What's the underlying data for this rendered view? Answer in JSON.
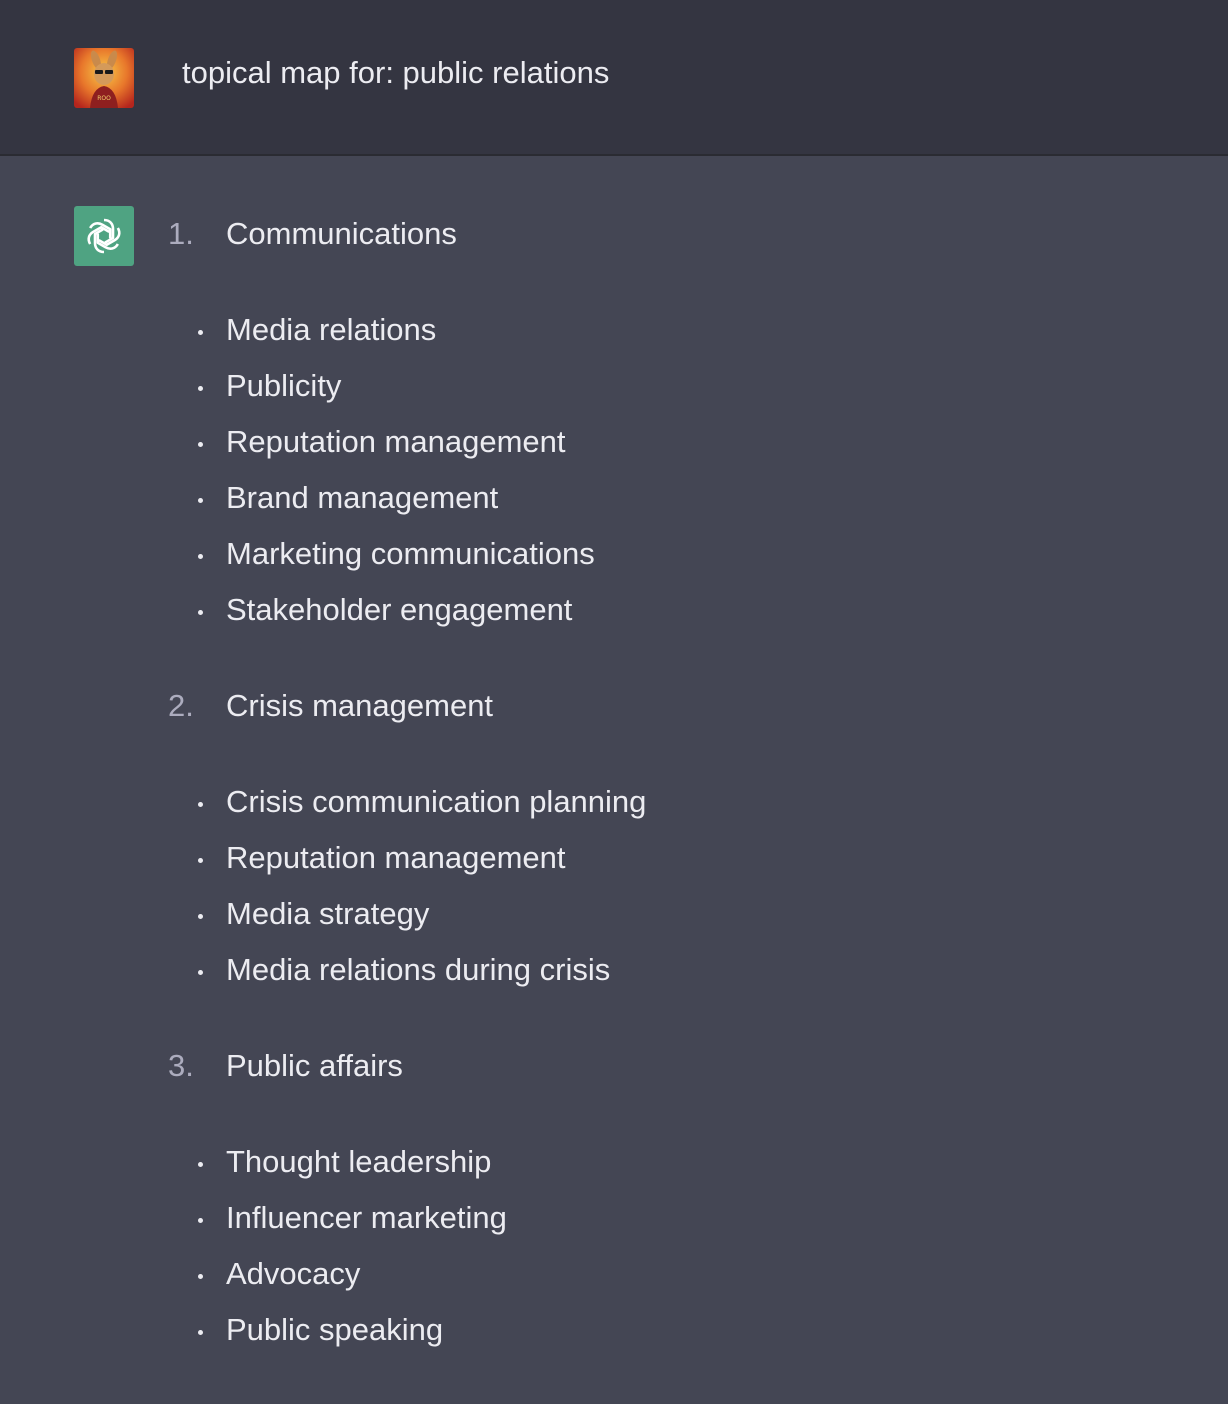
{
  "user_message": {
    "avatar_icon": "kangaroo-avatar-icon",
    "text": "topical map for: public relations"
  },
  "assistant_message": {
    "avatar_icon": "openai-logo-icon",
    "avatar_color": "#4fa382",
    "sections": [
      {
        "number": "1.",
        "title": "Communications",
        "items": [
          "Media relations",
          "Publicity",
          "Reputation management",
          "Brand management",
          "Marketing communications",
          "Stakeholder engagement"
        ]
      },
      {
        "number": "2.",
        "title": "Crisis management",
        "items": [
          "Crisis communication planning",
          "Reputation management",
          "Media strategy",
          "Media relations during crisis"
        ]
      },
      {
        "number": "3.",
        "title": "Public affairs",
        "items": [
          "Thought leadership",
          "Influencer marketing",
          "Advocacy",
          "Public speaking"
        ]
      }
    ]
  }
}
